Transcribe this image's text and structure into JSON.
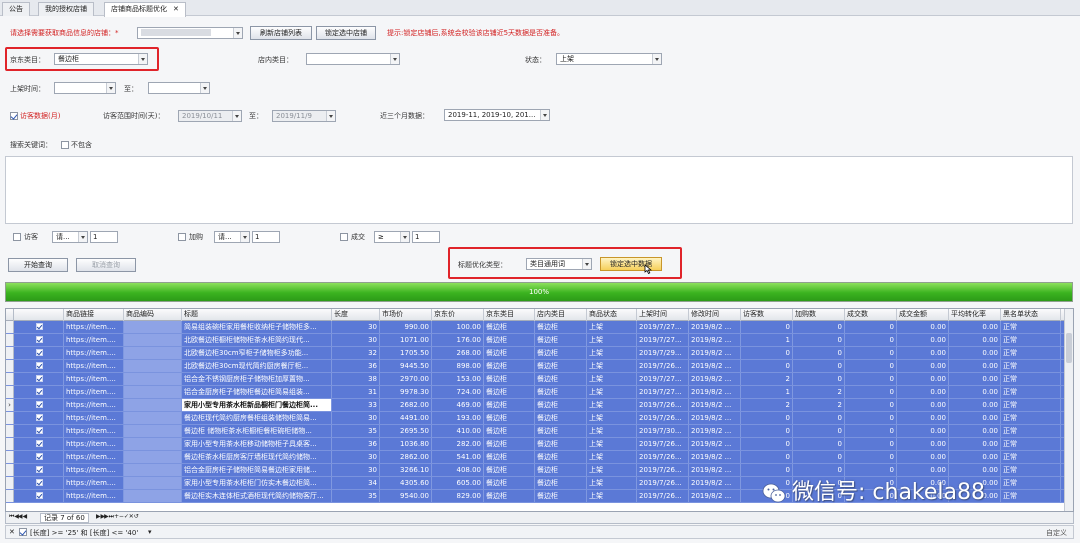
{
  "tabs": [
    {
      "label": "公告"
    },
    {
      "label": "我的授权店铺"
    },
    {
      "label": "店铺商品标题优化",
      "active": true
    }
  ],
  "form": {
    "shop_prompt": "请选择需要获取商品信息的店铺：*",
    "refresh_btn": "刷新店铺列表",
    "lock_shop_btn": "锁定选中店铺",
    "hint": "提示:锁定店铺后,系统会校验该店铺近5天数据是否准备。",
    "jd_category_label": "京东类目：",
    "jd_category_value": "餐边柜",
    "shop_category_label": "店内类目：",
    "status_label": "状态：",
    "status_value": "上架",
    "listing_time_label": "上架时间：",
    "to_label": "至：",
    "visitor_data_label": "访客数据(月)",
    "visit_range_label": "访客范围时间(天)：",
    "visit_from": "2019/10/11",
    "visit_to_label": "至：",
    "visit_to": "2019/11/9",
    "recent_months_label": "近三个月数据：",
    "recent_months_value": "2019-11, 2019-10, 201...",
    "exclude_keyword_label": "搜索关键词：",
    "exclude_label": "不包含",
    "visitor_filter_label": "访客",
    "visitor_op": "请...",
    "visitor_val": "1",
    "cart_filter_label": "加购",
    "cart_op": "请...",
    "cart_val": "1",
    "deal_filter_label": "成交",
    "deal_op": "≥",
    "deal_val": "1",
    "start_query_btn": "开始查询",
    "cancel_query_btn": "取消查询",
    "title_opt_type_label": "标题优化类型：",
    "title_opt_type_value": "类目通用词",
    "lock_data_btn": "锁定选中数据"
  },
  "progress": {
    "value": 100,
    "label": "100%"
  },
  "grid": {
    "columns": [
      "",
      "商品链接",
      "商品编码",
      "标题",
      "长度",
      "市场价",
      "京东价",
      "京东类目",
      "店内类目",
      "商品状态",
      "上架时间",
      "修改时间",
      "访客数",
      "加购数",
      "成交数",
      "成交金额",
      "平均转化率",
      "黑名单状态"
    ],
    "rows": [
      {
        "link": "https://item....",
        "title": "简易组装碗柜家用餐柜收纳柜子储物柜多...",
        "len": "30",
        "market": "990.00",
        "jd": "100.00",
        "jdcat": "餐边柜",
        "shopcat": "餐边柜",
        "status": "上架",
        "up": "2019/7/27...",
        "mod": "2019/8/2 ...",
        "visitors": "0",
        "cart": "0",
        "deal": "0",
        "amount": "0.00",
        "conv": "0.00",
        "black": "正常"
      },
      {
        "link": "https://item....",
        "title": "北欧餐边柜橱柜储物柜茶水柜简约现代...",
        "len": "30",
        "market": "1071.00",
        "jd": "176.00",
        "jdcat": "餐边柜",
        "shopcat": "餐边柜",
        "status": "上架",
        "up": "2019/7/27...",
        "mod": "2019/8/2 ...",
        "visitors": "1",
        "cart": "0",
        "deal": "0",
        "amount": "0.00",
        "conv": "0.00",
        "black": "正常"
      },
      {
        "link": "https://item....",
        "title": "北欧餐边柜30cm窄柜子储物柜多功能...",
        "len": "32",
        "market": "1705.50",
        "jd": "268.00",
        "jdcat": "餐边柜",
        "shopcat": "餐边柜",
        "status": "上架",
        "up": "2019/7/29...",
        "mod": "2019/8/2 ...",
        "visitors": "0",
        "cart": "0",
        "deal": "0",
        "amount": "0.00",
        "conv": "0.00",
        "black": "正常"
      },
      {
        "link": "https://item....",
        "title": "北欧餐边柜30cm现代简约厨房餐厅柜...",
        "len": "36",
        "market": "9445.50",
        "jd": "898.00",
        "jdcat": "餐边柜",
        "shopcat": "餐边柜",
        "status": "上架",
        "up": "2019/7/26...",
        "mod": "2019/8/2 ...",
        "visitors": "0",
        "cart": "0",
        "deal": "0",
        "amount": "0.00",
        "conv": "0.00",
        "black": "正常"
      },
      {
        "link": "https://item....",
        "title": "铝合金不锈钢厨房柜子储物柜加厚置物...",
        "len": "38",
        "market": "2970.00",
        "jd": "153.00",
        "jdcat": "餐边柜",
        "shopcat": "餐边柜",
        "status": "上架",
        "up": "2019/7/27...",
        "mod": "2019/8/2 ...",
        "visitors": "2",
        "cart": "0",
        "deal": "0",
        "amount": "0.00",
        "conv": "0.00",
        "black": "正常"
      },
      {
        "link": "https://item....",
        "title": "铝合金厨房柜子储物柜餐边柜简易组装...",
        "len": "31",
        "market": "9978.30",
        "jd": "724.00",
        "jdcat": "餐边柜",
        "shopcat": "餐边柜",
        "status": "上架",
        "up": "2019/7/27...",
        "mod": "2019/8/2 ...",
        "visitors": "1",
        "cart": "2",
        "deal": "0",
        "amount": "0.00",
        "conv": "0.00",
        "black": "正常"
      },
      {
        "link": "https://item....",
        "title": "家用小型专用茶水柜新品橱柜门餐边柜简...",
        "len": "33",
        "market": "2682.00",
        "jd": "469.00",
        "jdcat": "餐边柜",
        "shopcat": "餐边柜",
        "status": "上架",
        "up": "2019/7/26...",
        "mod": "2019/8/2 ...",
        "visitors": "2",
        "cart": "2",
        "deal": "0",
        "amount": "0.00",
        "conv": "0.00",
        "black": "正常",
        "current": true
      },
      {
        "link": "https://item....",
        "title": "餐边柜现代简约厨房餐柜组装储物柜简易...",
        "len": "30",
        "market": "4491.00",
        "jd": "193.00",
        "jdcat": "餐边柜",
        "shopcat": "餐边柜",
        "status": "上架",
        "up": "2019/7/26...",
        "mod": "2019/8/2 ...",
        "visitors": "0",
        "cart": "0",
        "deal": "0",
        "amount": "0.00",
        "conv": "0.00",
        "black": "正常"
      },
      {
        "link": "https://item....",
        "title": "餐边柜 储物柜茶水柜橱柜餐柜碗柜储物...",
        "len": "35",
        "market": "2695.50",
        "jd": "410.00",
        "jdcat": "餐边柜",
        "shopcat": "餐边柜",
        "status": "上架",
        "up": "2019/7/30...",
        "mod": "2019/8/2 ...",
        "visitors": "0",
        "cart": "0",
        "deal": "0",
        "amount": "0.00",
        "conv": "0.00",
        "black": "正常"
      },
      {
        "link": "https://item....",
        "title": "家用小型专用茶水柜移动储物柜子具桌客...",
        "len": "36",
        "market": "1036.80",
        "jd": "282.00",
        "jdcat": "餐边柜",
        "shopcat": "餐边柜",
        "status": "上架",
        "up": "2019/7/26...",
        "mod": "2019/8/2 ...",
        "visitors": "0",
        "cart": "0",
        "deal": "0",
        "amount": "0.00",
        "conv": "0.00",
        "black": "正常"
      },
      {
        "link": "https://item....",
        "title": "餐边柜茶水柜厨房客厅墙柜现代简约储物...",
        "len": "30",
        "market": "2862.00",
        "jd": "541.00",
        "jdcat": "餐边柜",
        "shopcat": "餐边柜",
        "status": "上架",
        "up": "2019/7/26...",
        "mod": "2019/8/2 ...",
        "visitors": "0",
        "cart": "0",
        "deal": "0",
        "amount": "0.00",
        "conv": "0.00",
        "black": "正常"
      },
      {
        "link": "https://item....",
        "title": "铝合金厨房柜子储物柜简易餐边柜家用储...",
        "len": "30",
        "market": "3266.10",
        "jd": "408.00",
        "jdcat": "餐边柜",
        "shopcat": "餐边柜",
        "status": "上架",
        "up": "2019/7/26...",
        "mod": "2019/8/2 ...",
        "visitors": "0",
        "cart": "0",
        "deal": "0",
        "amount": "0.00",
        "conv": "0.00",
        "black": "正常"
      },
      {
        "link": "https://item....",
        "title": "家用小型专用茶水柜柜门仿实木餐边柜简...",
        "len": "34",
        "market": "4305.60",
        "jd": "605.00",
        "jdcat": "餐边柜",
        "shopcat": "餐边柜",
        "status": "上架",
        "up": "2019/7/26...",
        "mod": "2019/8/2 ...",
        "visitors": "0",
        "cart": "0",
        "deal": "0",
        "amount": "0.00",
        "conv": "0.00",
        "black": "正常"
      },
      {
        "link": "https://item....",
        "title": "餐边柜实木连体柜式酒柜现代简约储物客厅...",
        "len": "35",
        "market": "9540.00",
        "jd": "829.00",
        "jdcat": "餐边柜",
        "shopcat": "餐边柜",
        "status": "上架",
        "up": "2019/7/26...",
        "mod": "2019/8/2 ...",
        "visitors": "0",
        "cart": "0",
        "deal": "0",
        "amount": "0.00",
        "conv": "0.00",
        "black": "正常"
      }
    ]
  },
  "navbar": {
    "record": "记录 7 of 60"
  },
  "filterbar": {
    "expr": "[长度] >= '25' 和 [长度] <= '40'",
    "custom": "自定义"
  },
  "watermark": {
    "text": "微信号: chakela88"
  },
  "colors": {
    "selection": "#5b79d6",
    "highlight_box": "#e0242a",
    "progress": "#3bb320"
  }
}
